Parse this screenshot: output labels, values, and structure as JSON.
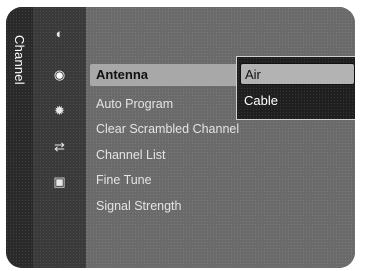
{
  "sidebar": {
    "label": "Channel"
  },
  "categories": [
    {
      "icon": "picture-icon",
      "glyph": "◐"
    },
    {
      "icon": "channel-icon",
      "glyph": "◉"
    },
    {
      "icon": "setup-icon",
      "glyph": "✹"
    },
    {
      "icon": "input-icon",
      "glyph": "⇄"
    },
    {
      "icon": "application-icon",
      "glyph": "▣"
    }
  ],
  "menu": {
    "items": [
      "Antenna",
      "Auto Program",
      "Clear Scrambled Channel",
      "Channel List",
      "Fine Tune",
      "Signal Strength"
    ],
    "selected_index": 0
  },
  "submenu": {
    "options": [
      "Air",
      "Cable"
    ],
    "selected_index": 0
  },
  "colors": {
    "panel": "#6a6a6a",
    "highlight": "#a8a8a8",
    "submenu_bg": "#1f1f1f"
  }
}
